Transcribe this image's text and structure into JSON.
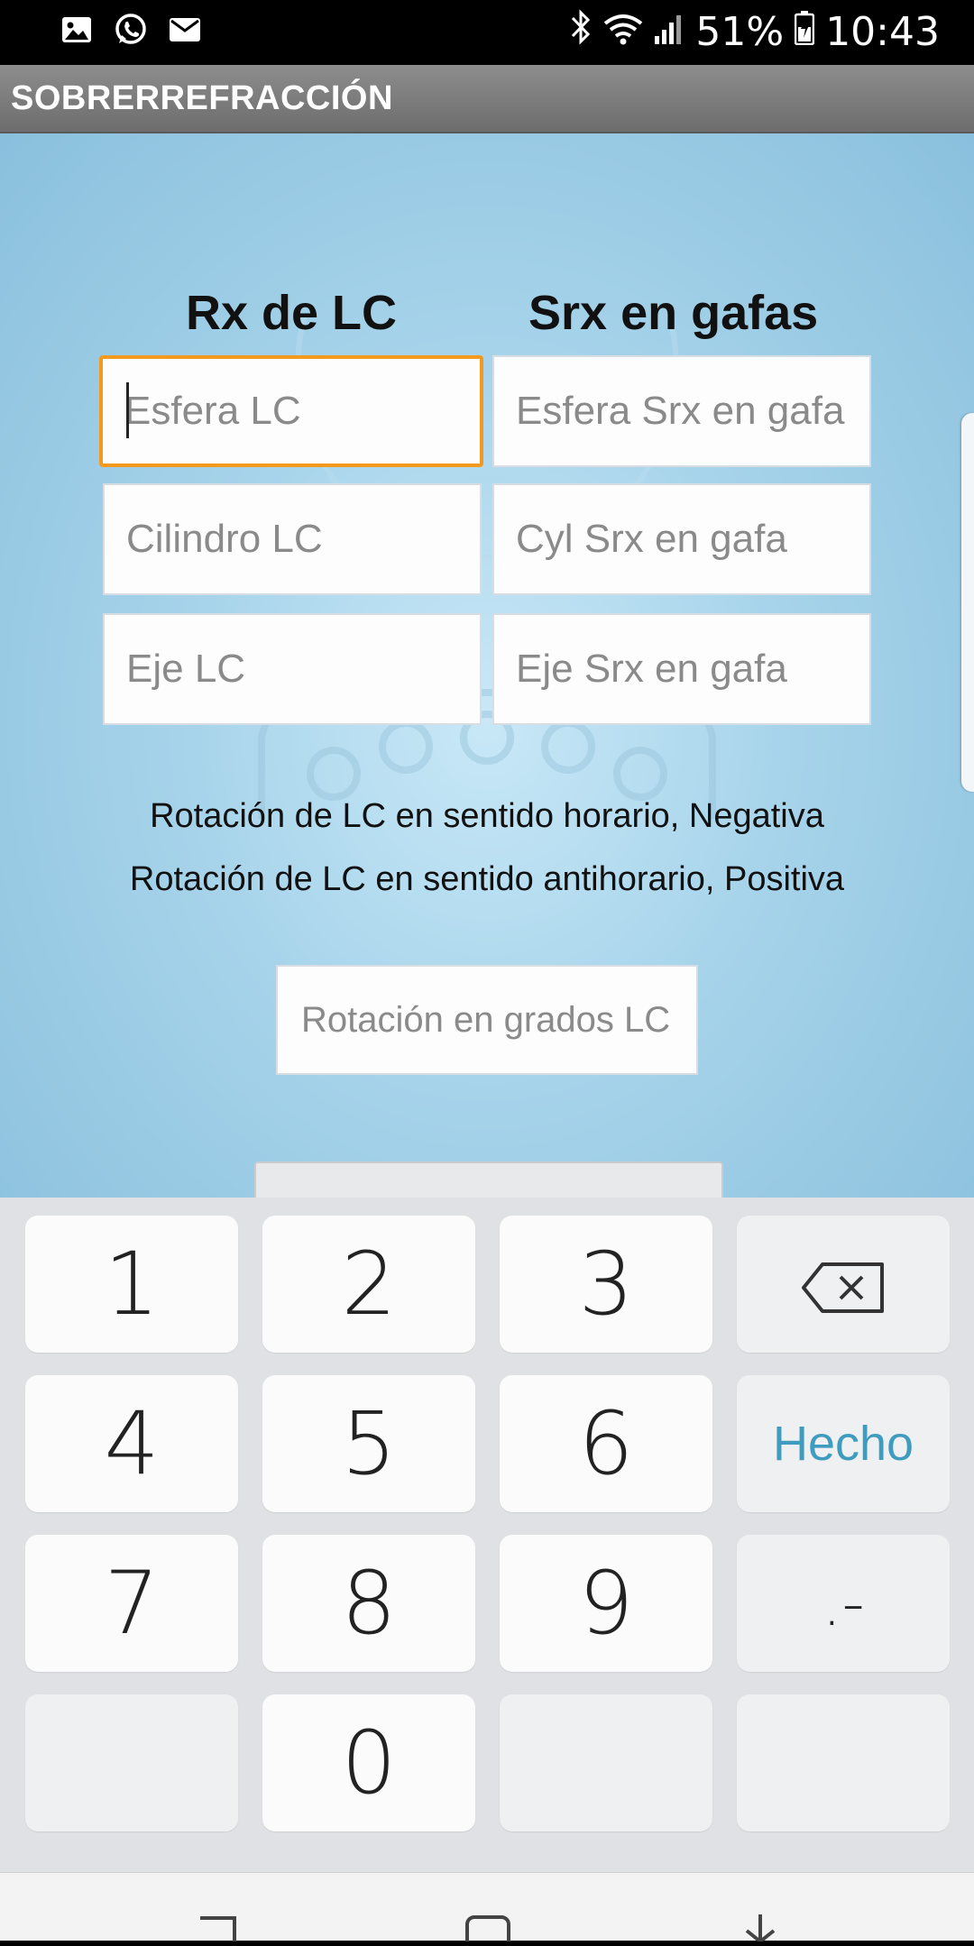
{
  "status_bar": {
    "battery": "51%",
    "time": "10:43",
    "left_icons": [
      "image-icon",
      "whatsapp-icon",
      "mail-icon"
    ],
    "right_icons": [
      "bluetooth-icon",
      "wifi-icon",
      "signal-icon",
      "battery-icon"
    ]
  },
  "app": {
    "title": "SOBRERREFRACCIÓN"
  },
  "columns": {
    "left_heading": "Rx de LC",
    "right_heading": "Srx en gafas"
  },
  "fields": {
    "esfera_lc": "Esfera LC",
    "esfera_srx": "Esfera Srx en gafa",
    "cilindro_lc": "Cilindro LC",
    "cyl_srx": "Cyl Srx en gafa",
    "eje_lc": "Eje LC",
    "eje_srx": "Eje Srx en gafa",
    "rotacion": "Rotación en grados LC"
  },
  "notes": {
    "line1": "Rotación de LC en sentido horario, Negativa",
    "line2": "Rotación de LC en sentido antihorario, Positiva"
  },
  "keyboard": {
    "keys": [
      "1",
      "2",
      "3",
      "4",
      "5",
      "6",
      "7",
      "8",
      "9",
      "0"
    ],
    "done_label": "Hecho",
    "dot_dash_label": ".-",
    "backspace_icon": "backspace-icon"
  },
  "colors": {
    "focus_border": "#f39a1e",
    "done_text": "#3f9cbf",
    "app_bar": "#7d7d7d",
    "keyboard_bg": "#dfe1e4"
  }
}
